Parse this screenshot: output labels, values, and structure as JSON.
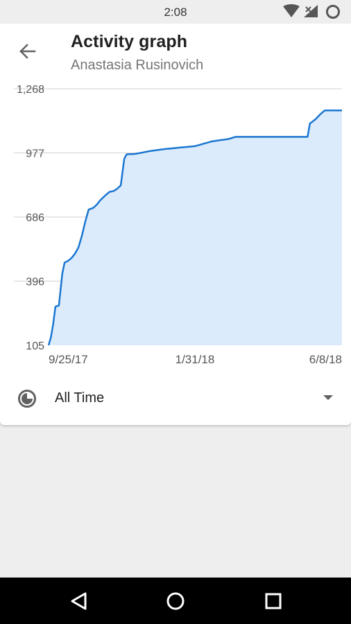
{
  "status_bar": {
    "time": "2:08",
    "icons": [
      "wifi-icon",
      "cellular-no-signal-icon",
      "battery-icon"
    ]
  },
  "header": {
    "back_icon": "arrow-back-icon",
    "title": "Activity graph",
    "subtitle": "Anastasia Rusinovich"
  },
  "range_selector": {
    "icon": "time-range-icon",
    "selected": "All Time",
    "dropdown_icon": "arrow-drop-down-icon"
  },
  "nav_bar": {
    "buttons": [
      "back-triangle-icon",
      "home-circle-icon",
      "recents-square-icon"
    ]
  },
  "colors": {
    "line": "#1976d2",
    "fill": "#dcebfb",
    "grid": "#d9d9d9",
    "axis_text": "#555555"
  },
  "chart_data": {
    "type": "area",
    "x_tick_labels": [
      "9/25/17",
      "1/31/18",
      "6/8/18"
    ],
    "y_tick_labels": [
      "1,268",
      "977",
      "686",
      "396",
      "105"
    ],
    "ylim": [
      105,
      1268
    ],
    "x_domain": [
      "2017-09-25",
      "2018-06-08"
    ],
    "grid": true,
    "series": [
      {
        "x": [
          "2017-09-25",
          "2017-09-27",
          "2017-09-29",
          "2017-10-01",
          "2017-10-04",
          "2017-10-07",
          "2017-10-09",
          "2017-10-12",
          "2017-10-15",
          "2017-10-18",
          "2017-10-21",
          "2017-10-24",
          "2017-10-27",
          "2017-10-30",
          "2017-11-03",
          "2017-11-06",
          "2017-11-09",
          "2017-11-13",
          "2017-11-17",
          "2017-11-21",
          "2017-11-24",
          "2017-11-27",
          "2017-11-30",
          "2017-12-02",
          "2017-12-05",
          "2017-12-07",
          "2017-12-10",
          "2017-12-15",
          "2017-12-22",
          "2017-12-29",
          "2018-01-05",
          "2018-01-15",
          "2018-01-31",
          "2018-02-15",
          "2018-03-01",
          "2018-03-07",
          "2018-03-13",
          "2018-03-20",
          "2018-04-01",
          "2018-04-20",
          "2018-05-09",
          "2018-05-11",
          "2018-05-16",
          "2018-05-20",
          "2018-05-24",
          "2018-05-29",
          "2018-06-08"
        ],
        "values": [
          105,
          140,
          200,
          280,
          285,
          430,
          480,
          488,
          500,
          520,
          548,
          600,
          665,
          720,
          728,
          742,
          762,
          782,
          800,
          805,
          815,
          830,
          950,
          970,
          972,
          972,
          973,
          978,
          985,
          990,
          995,
          1000,
          1008,
          1030,
          1040,
          1050,
          1050,
          1050,
          1050,
          1050,
          1050,
          1110,
          1130,
          1152,
          1170,
          1170,
          1170
        ]
      }
    ]
  }
}
